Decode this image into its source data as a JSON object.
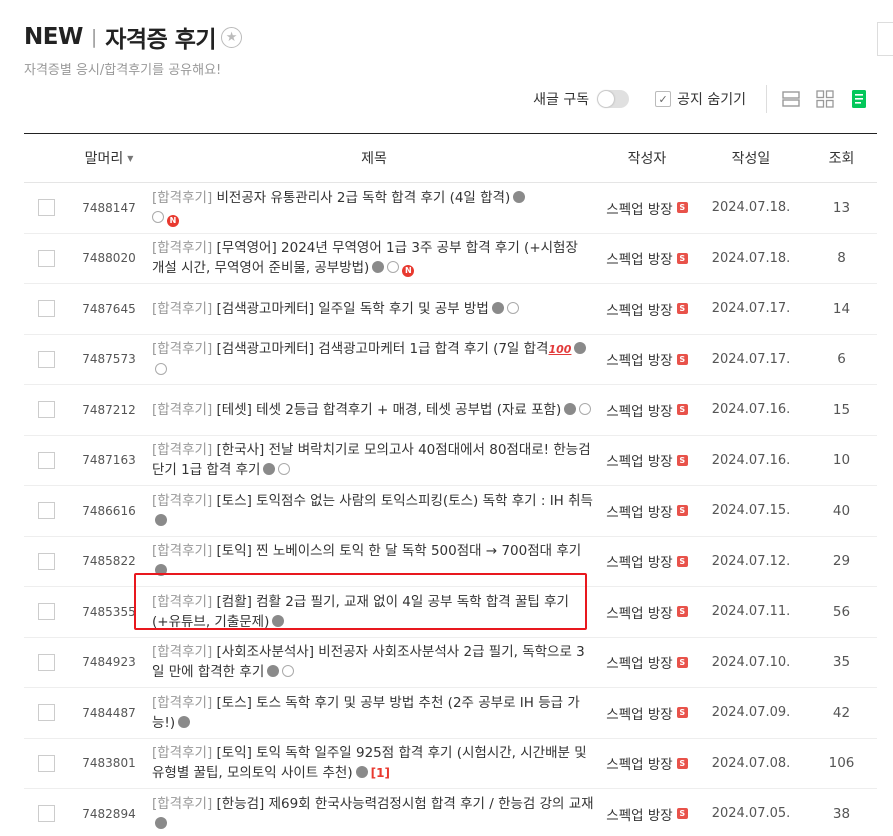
{
  "header": {
    "title_new": "NEW",
    "title_sep": "|",
    "title_main": "자격증 후기",
    "subtitle": "자격증별 응시/합격후기를 공유해요!"
  },
  "toolbar": {
    "subscribe_label": "새글 구독",
    "hide_notice_label": "공지 숨기기",
    "checkmark": "✓"
  },
  "table": {
    "headers": {
      "prefix": "말머리",
      "title": "제목",
      "author": "작성자",
      "date": "작성일",
      "views": "조회"
    },
    "staff_badge": "S",
    "rows": [
      {
        "no": "7488147",
        "prefix": "[합격후기]",
        "title": "비전공자 유통관리사 2급 독학 합격 후기 (4일 합격)",
        "author": "스펙업 방장",
        "date": "2024.07.18.",
        "views": "13"
      },
      {
        "no": "7488020",
        "prefix": "[합격후기]",
        "title": "[무역영어] 2024년 무역영어 1급 3주 공부 합격 후기 (+시험장 개설 시간, 무역영어 준비물, 공부방법)",
        "author": "스펙업 방장",
        "date": "2024.07.18.",
        "views": "8"
      },
      {
        "no": "7487645",
        "prefix": "[합격후기]",
        "title": "[검색광고마케터] 일주일 독학 후기 및 공부 방법",
        "author": "스펙업 방장",
        "date": "2024.07.17.",
        "views": "14"
      },
      {
        "no": "7487573",
        "prefix": "[합격후기]",
        "title": "[검색광고마케터] 검색광고마케터 1급 합격 후기 (7일 합격",
        "author": "스펙업 방장",
        "date": "2024.07.17.",
        "views": "6"
      },
      {
        "no": "7487212",
        "prefix": "[합격후기]",
        "title": "[테셋] 테셋 2등급 합격후기 + 매경, 테셋 공부법 (자료 포함)",
        "author": "스펙업 방장",
        "date": "2024.07.16.",
        "views": "15"
      },
      {
        "no": "7487163",
        "prefix": "[합격후기]",
        "title": "[한국사] 전날 벼락치기로 모의고사 40점대에서 80점대로! 한능검 단기 1급 합격 후기",
        "author": "스펙업 방장",
        "date": "2024.07.16.",
        "views": "10"
      },
      {
        "no": "7486616",
        "prefix": "[합격후기]",
        "title": "[토스] 토익점수 없는 사람의 토익스피킹(토스) 독학 후기 : IH 취득",
        "author": "스펙업 방장",
        "date": "2024.07.15.",
        "views": "40"
      },
      {
        "no": "7485822",
        "prefix": "[합격후기]",
        "title": "[토익] 찐 노베이스의 토익 한 달 독학 500점대 → 700점대 후기",
        "author": "스펙업 방장",
        "date": "2024.07.12.",
        "views": "29"
      },
      {
        "no": "7485355",
        "prefix": "[합격후기]",
        "title": "[컴활] 컴활 2급 필기, 교재 없이 4일 공부 독학 합격 꿀팁 후기 (+유튜브, 기출문제)",
        "author": "스펙업 방장",
        "date": "2024.07.11.",
        "views": "56"
      },
      {
        "no": "7484923",
        "prefix": "[합격후기]",
        "title": "[사회조사분석사] 비전공자 사회조사분석사 2급 필기, 독학으로 3일 만에 합격한 후기",
        "author": "스펙업 방장",
        "date": "2024.07.10.",
        "views": "35"
      },
      {
        "no": "7484487",
        "prefix": "[합격후기]",
        "title": "[토스] 토스 독학 후기 및 공부 방법 추천 (2주 공부로 IH 등급 가능!)",
        "author": "스펙업 방장",
        "date": "2024.07.09.",
        "views": "42"
      },
      {
        "no": "7483801",
        "prefix": "[합격후기]",
        "title": "[토익] 토익 독학 일주일 925점 합격 후기 (시험시간, 시간배분 및 유형별 꿀팁, 모의토익 사이트 추천)",
        "author": "스펙업 방장",
        "date": "2024.07.08.",
        "views": "106"
      },
      {
        "no": "7482894",
        "prefix": "[합격후기]",
        "title": "[한능검] 제69회 한국사능력검정시험 합격 후기 / 한능검 강의 교재",
        "author": "스펙업 방장",
        "date": "2024.07.05.",
        "views": "38"
      }
    ],
    "new_badge": "N",
    "emoji_100": "100",
    "comment_count_7483801": "[1]"
  }
}
